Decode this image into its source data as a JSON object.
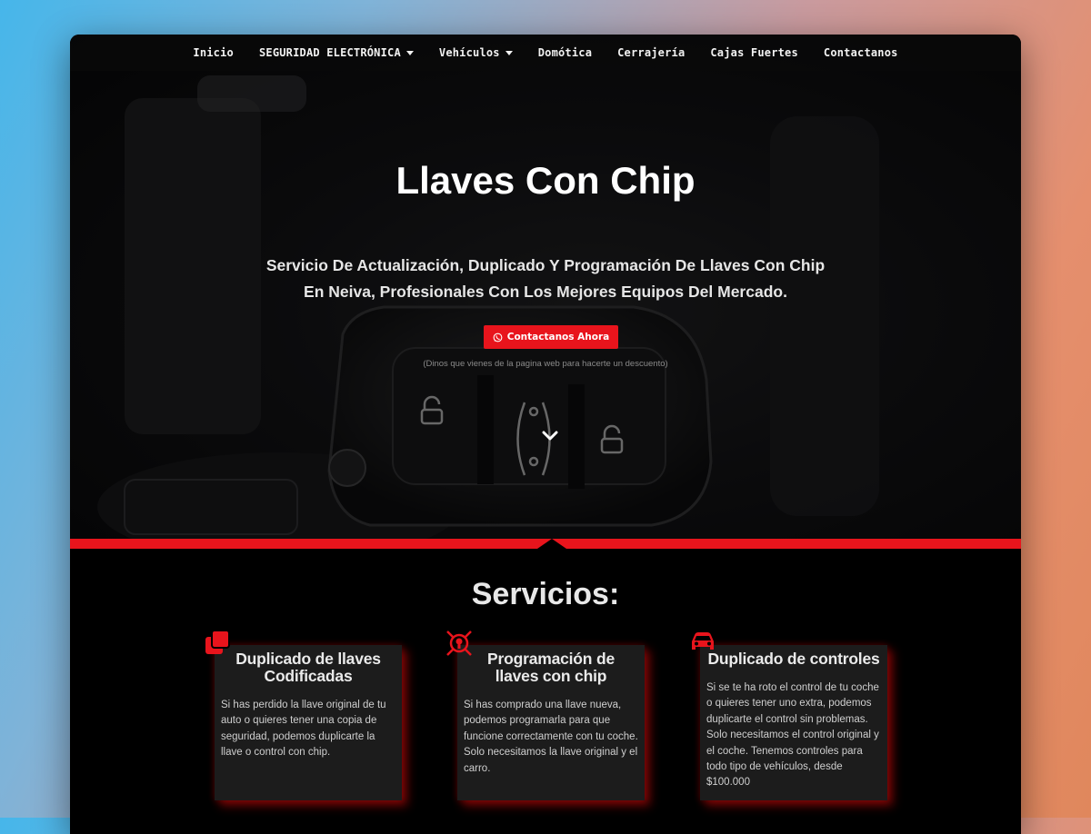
{
  "nav": {
    "items": [
      {
        "label": "Inicio",
        "dropdown": false
      },
      {
        "label": "SEGURIDAD ELECTRÓNICA",
        "dropdown": true
      },
      {
        "label": "Vehículos",
        "dropdown": true
      },
      {
        "label": "Domótica",
        "dropdown": false
      },
      {
        "label": "Cerrajería",
        "dropdown": false
      },
      {
        "label": "Cajas Fuertes",
        "dropdown": false
      },
      {
        "label": "Contactanos",
        "dropdown": false
      }
    ]
  },
  "hero": {
    "title": "Llaves Con Chip",
    "subtitle": "Servicio De Actualización, Duplicado Y Programación De Llaves Con Chip En Neiva, Profesionales Con Los Mejores Equipos Del Mercado.",
    "cta_label": "Contactanos Ahora",
    "cta_icon": "whatsapp-icon",
    "cta_note": "(Dinos que vienes de la pagina web para hacerte un descuento)"
  },
  "services": {
    "title": "Servicios:",
    "cards": [
      {
        "icon": "copy-icon",
        "title": "Duplicado de llaves Codificadas",
        "body": "Si has perdido la llave original de tu auto o quieres tener una copia de seguridad, podemos duplicarte la llave o control con chip."
      },
      {
        "icon": "chip-target-icon",
        "title": "Programación de llaves con chip",
        "body": "Si has comprado una llave nueva, podemos programarla para que funcione correctamente con tu coche. Solo necesitamos la llave original y el carro."
      },
      {
        "icon": "car-icon",
        "title": "Duplicado de controles",
        "body": "Si se te ha roto el control de tu coche o quieres tener uno extra, podemos duplicarte el control sin problemas. Solo necesitamos el control original y el coche. Tenemos controles para todo tipo de vehículos, desde $100.000"
      }
    ]
  },
  "colors": {
    "accent": "#e8141c",
    "card_bg": "#1c1c1c",
    "page_bg": "#000000"
  }
}
